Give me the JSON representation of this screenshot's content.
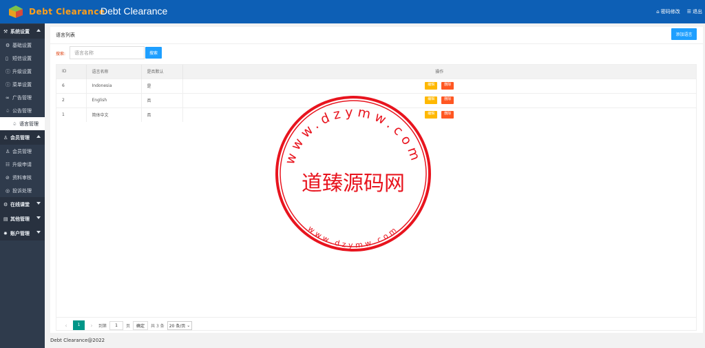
{
  "header": {
    "logo_text": "Debt Clearance",
    "title": "Debt Clearance",
    "change_password": "密码修改",
    "logout": "退出"
  },
  "sidebar": {
    "groups": [
      {
        "label": "系统设置",
        "icon": "settings-icon",
        "expanded": true,
        "items": [
          {
            "label": "基础设置",
            "icon": "gear-icon"
          },
          {
            "label": "短信设置",
            "icon": "phone-icon"
          },
          {
            "label": "升级设置",
            "icon": "info-icon"
          },
          {
            "label": "菜单设置",
            "icon": "info-icon"
          },
          {
            "label": "广告管理",
            "icon": "link-icon"
          },
          {
            "label": "公告管理",
            "icon": "bell-icon"
          },
          {
            "label": "语言管理",
            "icon": "bell-icon",
            "active": true
          }
        ]
      },
      {
        "label": "会员管理",
        "icon": "group-icon",
        "expanded": true,
        "items": [
          {
            "label": "会员管理",
            "icon": "user-icon"
          },
          {
            "label": "升级申请",
            "icon": "list-icon"
          },
          {
            "label": "资料审核",
            "icon": "check-icon"
          },
          {
            "label": "投诉处理",
            "icon": "circle-icon"
          }
        ]
      },
      {
        "label": "在线课堂",
        "icon": "gear-icon",
        "expanded": false,
        "items": []
      },
      {
        "label": "其他管理",
        "icon": "doc-icon",
        "expanded": false,
        "items": []
      },
      {
        "label": "账户管理",
        "icon": "star-icon",
        "expanded": false,
        "items": []
      }
    ]
  },
  "main": {
    "panel_title": "语言列表",
    "add_button": "添加语言",
    "search_label": "搜索:",
    "search_placeholder": "语言名称",
    "search_button": "搜索",
    "columns": [
      "ID",
      "语言名称",
      "是否默认",
      "操作"
    ],
    "rows": [
      {
        "id": "6",
        "name": "Indonesia",
        "default": "是"
      },
      {
        "id": "2",
        "name": "English",
        "default": "否"
      },
      {
        "id": "1",
        "name": "简体中文",
        "default": "否"
      }
    ],
    "edit_label": "编辑",
    "delete_label": "删除",
    "pager": {
      "current_page": "1",
      "goto_label": "到第",
      "goto_value": "1",
      "page_unit": "页",
      "confirm": "确定",
      "total": "共 3 条",
      "page_size": "20 条/页"
    }
  },
  "footer": {
    "text": "Debt Clearance@2022"
  },
  "watermark": {
    "main_text": "道臻源码网",
    "top_arc": "www.dzymw.com",
    "bottom_arc": "www.dzymw.com",
    "color": "#e8141e"
  }
}
